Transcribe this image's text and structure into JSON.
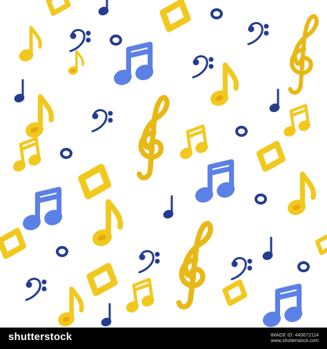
{
  "colors": {
    "yellow": "#f2c81e",
    "yellow_dark": "#d79a0c",
    "blue": "#5b80e6",
    "navy": "#243d8e",
    "background": "#ffffff",
    "footer_bg": "#000000"
  },
  "pattern": {
    "icons": [
      "treble-clef-icon",
      "bass-clef-icon",
      "eighth-note-icon",
      "beamed-notes-icon",
      "quarter-note-icon",
      "whole-note-icon"
    ],
    "palette": [
      "yellow",
      "blue",
      "navy"
    ]
  },
  "footer": {
    "brand": "shutterstock",
    "image_id_label": "IMAGE ID: 440672114",
    "site": "www.shutterstock.com"
  }
}
